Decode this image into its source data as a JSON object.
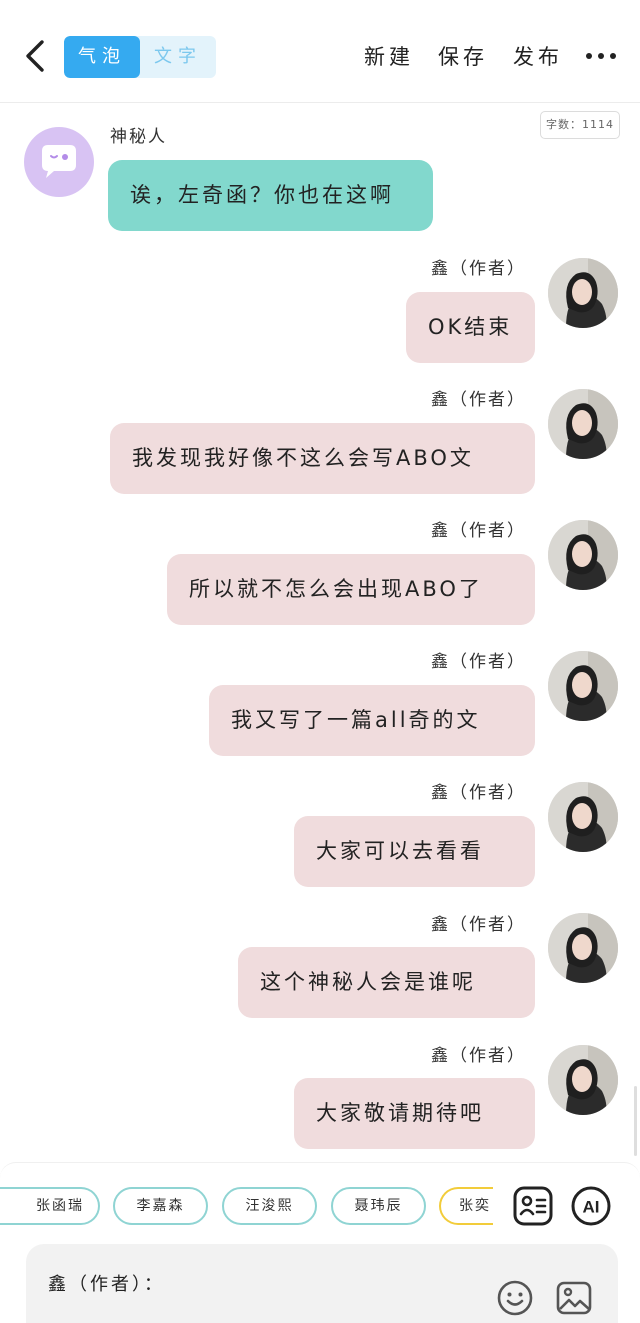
{
  "header": {
    "tabs": [
      "气泡",
      "文字"
    ],
    "active_tab": "气泡",
    "actions": {
      "new": "新建",
      "save": "保存",
      "publish": "发布"
    }
  },
  "word_count": "字数：1114",
  "messages": [
    {
      "sender": "神秘人",
      "text": "诶，左奇函？你也在这啊",
      "side": "left",
      "bubble_color": "#82d8cd"
    },
    {
      "sender": "鑫（作者）",
      "text": "OK结束",
      "side": "right",
      "bubble_color": "#f0dcdd"
    },
    {
      "sender": "鑫（作者）",
      "text": "我发现我好像不这么会写ABO文",
      "side": "right",
      "bubble_color": "#f0dcdd"
    },
    {
      "sender": "鑫（作者）",
      "text": "所以就不怎么会出现ABO了",
      "side": "right",
      "bubble_color": "#f0dcdd"
    },
    {
      "sender": "鑫（作者）",
      "text": "我又写了一篇all奇的文",
      "side": "right",
      "bubble_color": "#f0dcdd"
    },
    {
      "sender": "鑫（作者）",
      "text": "大家可以去看看",
      "side": "right",
      "bubble_color": "#f0dcdd"
    },
    {
      "sender": "鑫（作者）",
      "text": "这个神秘人会是谁呢",
      "side": "right",
      "bubble_color": "#f0dcdd"
    },
    {
      "sender": "鑫（作者）",
      "text": "大家敬请期待吧",
      "side": "right",
      "bubble_color": "#f0dcdd"
    }
  ],
  "characters": [
    "张函瑞",
    "李嘉森",
    "汪浚熙",
    "聂玮辰",
    "张奕"
  ],
  "input": {
    "speaker_label": "鑫（作者）："
  },
  "colors": {
    "accent": "#35aaf0",
    "chip_border": "#8fd4d3",
    "chip_border_highlight": "#f2cc3a"
  },
  "icons": [
    "back-arrow-icon",
    "more-icon",
    "character-list-icon",
    "ai-icon",
    "emoji-icon",
    "image-icon"
  ]
}
